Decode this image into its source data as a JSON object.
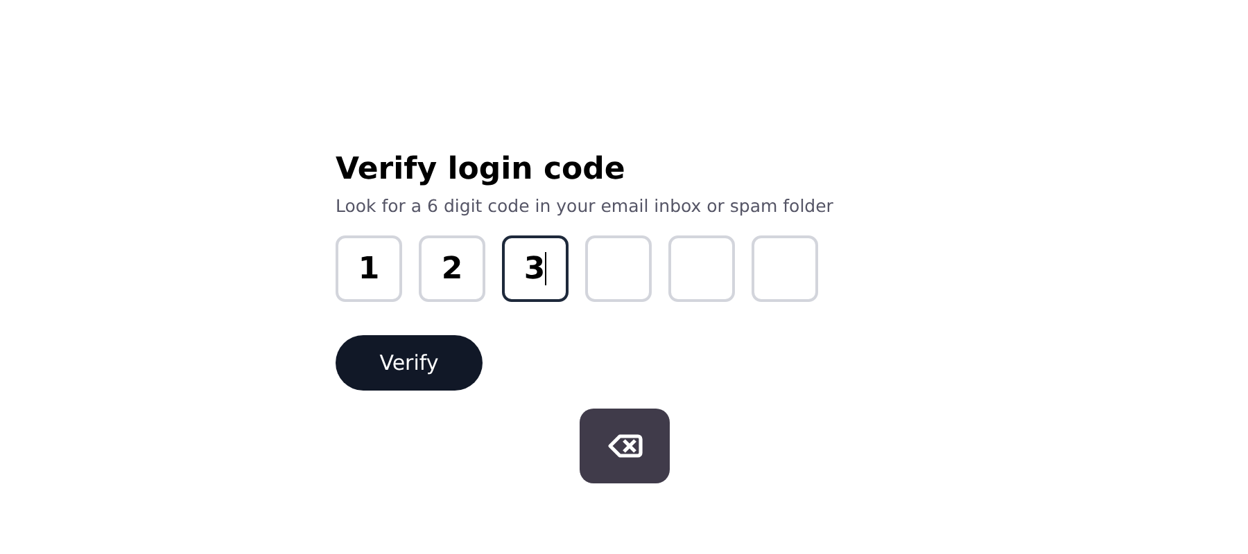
{
  "title": "Verify login code",
  "subtitle": "Look for a 6 digit code in your email inbox or spam folder",
  "digits": [
    {
      "value": "1",
      "focused": false
    },
    {
      "value": "2",
      "focused": false
    },
    {
      "value": "3",
      "focused": true
    },
    {
      "focused": false
    },
    {
      "focused": false
    },
    {
      "focused": false
    }
  ],
  "button": "Verify"
}
